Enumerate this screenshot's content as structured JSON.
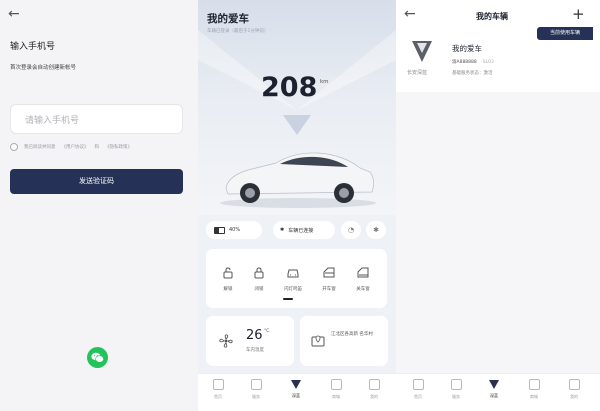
{
  "login": {
    "title": "输入手机号",
    "hint": "首次登录会自动创建新帐号",
    "phone_placeholder": "请输入手机号",
    "agreement_prefix": "我已阅读并同意",
    "agreement_user": "《用户协议》",
    "agreement_and": "和",
    "agreement_privacy": "《隐私政策》",
    "send_code_label": "发送验证码",
    "wechat_icon": "wechat-icon"
  },
  "car": {
    "title": "我的爱车",
    "subtitle": "车辆已登录（最后于1分钟前）",
    "mileage": "208",
    "mileage_unit": "km",
    "battery": "40%",
    "bluetooth_status": "车辆已连接",
    "controls": [
      {
        "label": "解锁",
        "icon": "unlock-icon"
      },
      {
        "label": "闭锁",
        "icon": "lock-icon"
      },
      {
        "label": "闪灯鸣笛",
        "icon": "car-front-icon"
      },
      {
        "label": "开车窗",
        "icon": "window-open-icon"
      },
      {
        "label": "关车窗",
        "icon": "window-close-icon"
      }
    ],
    "temp_value": "26",
    "temp_unit": "°C",
    "temp_label": "车内温度",
    "nav_text": "江北区各高新 名华村",
    "tabs": [
      "首页",
      "服务",
      "深蓝",
      "商城",
      "我的"
    ]
  },
  "garage": {
    "title": "我的车辆",
    "current_tag": "当前使用车辆",
    "car_name": "我的爱车",
    "plate": "渝A888888",
    "vin_hint": "SL03",
    "service_status": "基础服务状态：激活",
    "brand": "长安深蓝",
    "tabs": [
      "首页",
      "服务",
      "深蓝",
      "商城",
      "我的"
    ]
  },
  "colors": {
    "primary": "#253156",
    "wechat": "#22c35a",
    "page_bg": "#f4f4f6"
  }
}
